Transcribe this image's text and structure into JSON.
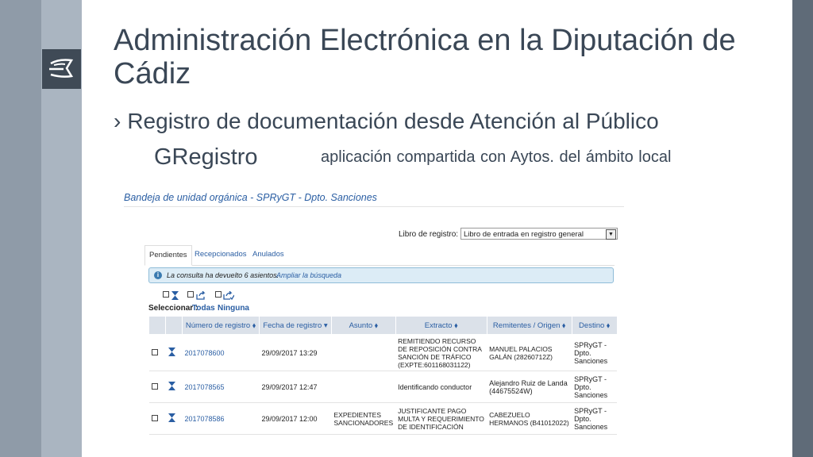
{
  "slide": {
    "title": "Administración Electrónica en la Diputación de Cádiz",
    "bullet_marker": "›",
    "bullet": "Registro de documentación desde Atención al Público",
    "app_name": "GRegistro",
    "app_note": "aplicación compartida con Aytos. del ámbito local"
  },
  "colors": {
    "accent": "#2a5ea3",
    "strip_dark": "#5f6b78",
    "strip_mid": "#8f9ba8",
    "strip_light": "#aab5c1"
  },
  "app": {
    "heading": "Bandeja de unidad orgánica - SPRyGT - Dpto. Sanciones",
    "libro_label": "Libro de registro:",
    "libro_value": "Libro de entrada en registro general",
    "tabs": [
      "Pendientes",
      "Recepcionados",
      "Anulados"
    ],
    "info_text": "La consulta ha devuelto 6 asientos.",
    "info_link": "Ampliar la búsqueda",
    "select_label": "Seleccionar :",
    "select_all": "Todas",
    "select_none": "Ninguna",
    "columns": [
      "Número de registro ⬧",
      "Fecha de registro ▾",
      "Asunto ⬧",
      "Extracto ⬧",
      "Remitentes / Origen ⬧",
      "Destino ⬧"
    ],
    "rows": [
      {
        "numero": "2017078600",
        "fecha": "29/09/2017 13:29",
        "asunto": "",
        "extracto": "REMITIENDO RECURSO DE REPOSICIÓN CONTRA SANCIÓN DE TRÁFICO (EXPTE:601168031122)",
        "remitente": "MANUEL PALACIOS GALÁN (28260712Z)",
        "destino": "SPRyGT - Dpto. Sanciones"
      },
      {
        "numero": "2017078565",
        "fecha": "29/09/2017 12:47",
        "asunto": "",
        "extracto": "Identificando conductor",
        "remitente": "Alejandro Ruiz de Landa (44675524W)",
        "destino": "SPRyGT - Dpto. Sanciones"
      },
      {
        "numero": "2017078586",
        "fecha": "29/09/2017 12:00",
        "asunto": "EXPEDIENTES SANCIONADORES",
        "extracto": "JUSTIFICANTE PAGO MULTA Y REQUERIMIENTO DE IDENTIFICACIÓN",
        "remitente": "CABEZUELO HERMANOS (B41012022)",
        "destino": "SPRyGT - Dpto. Sanciones"
      }
    ]
  }
}
